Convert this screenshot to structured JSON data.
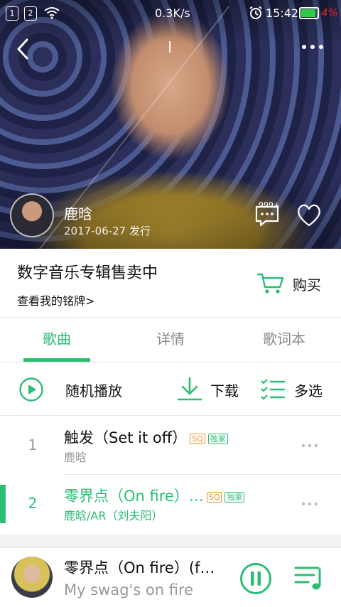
{
  "status_bar": {
    "sim1": "1",
    "sim2": "2",
    "net_speed": "0.3K/s",
    "time": "15:42",
    "battery_percent": "4%",
    "battery_level": 0.04,
    "icons": [
      "sim-icon",
      "wifi-icon",
      "alarm-icon",
      "battery-icon"
    ]
  },
  "header": {
    "back_icon": "chevron-left-icon",
    "more_icon": "more-dots-icon"
  },
  "album": {
    "artist": "鹿晗",
    "release": "2017-06-27 发行",
    "comment_count": "999+",
    "comment_icon": "comment-icon",
    "like_icon": "heart-icon"
  },
  "promo": {
    "title": "数字音乐专辑售卖中",
    "link": "查看我的铭牌>",
    "buy_label": "购买",
    "buy_icon": "cart-icon"
  },
  "tabs": [
    {
      "label": "歌曲",
      "active": true
    },
    {
      "label": "详情",
      "active": false
    },
    {
      "label": "歌词本",
      "active": false
    }
  ],
  "actions": {
    "shuffle": "随机播放",
    "download": "下载",
    "multi_select": "多选"
  },
  "songs": [
    {
      "index": "1",
      "title": "触发（Set it off）",
      "badges": [
        "SQ",
        "独家"
      ],
      "artist": "鹿晗",
      "playing": false
    },
    {
      "index": "2",
      "title": "零界点（On fire）…",
      "badges": [
        "SQ",
        "独家"
      ],
      "artist": "鹿晗/AR（刘夫阳）",
      "playing": true
    }
  ],
  "player": {
    "title": "零界点（On fire）(f…",
    "lyric": "My swag's on fire",
    "state": "playing"
  },
  "colors": {
    "accent": "#2bbd74",
    "sq_badge": "#f08c2c",
    "battery_low": "#e8232a"
  }
}
